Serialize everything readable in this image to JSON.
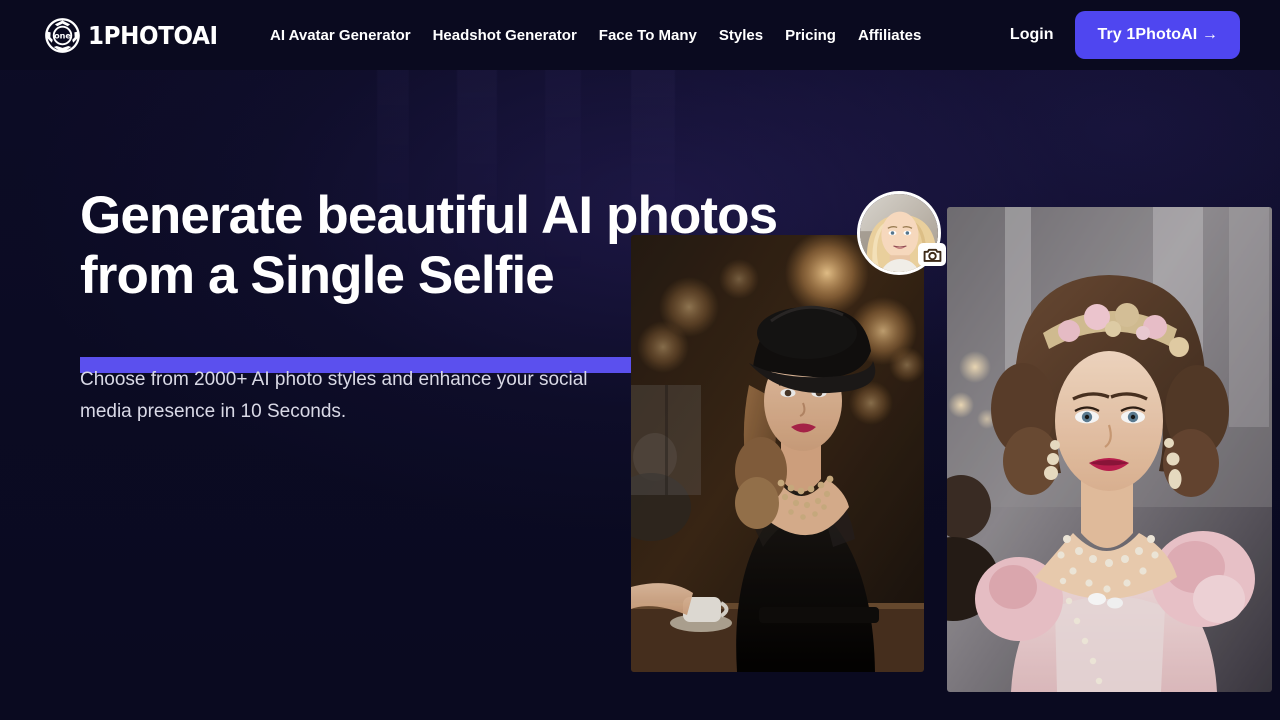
{
  "header": {
    "brand": {
      "name": "1PHOTOAI",
      "mark_label": "one",
      "icon": "aperture-icon"
    },
    "nav": [
      {
        "label": "AI Avatar Generator"
      },
      {
        "label": "Headshot Generator"
      },
      {
        "label": "Face To Many"
      },
      {
        "label": "Styles"
      },
      {
        "label": "Pricing"
      },
      {
        "label": "Affiliates"
      }
    ],
    "login_label": "Login",
    "cta_label": "Try 1PhotoAI →"
  },
  "hero": {
    "title_line_1": "Generate beautiful AI photos",
    "title_line_2": "from a Single Selfie",
    "subtitle": "Choose from 2000+ AI photo styles and enhance your social media presence in 10 Seconds.",
    "avatar_alt": "Blonde woman selfie avatar",
    "camera_icon": "camera-icon",
    "photos": [
      {
        "alt": "AI generated portrait of a woman in a black hat and black dress with a pearl necklace in a warmly lit cafe"
      },
      {
        "alt": "AI generated portrait of a woman in a pink gown with a floral tiara and layered pearl necklaces"
      }
    ]
  },
  "colors": {
    "background": "#0b0b24",
    "header_background": "#0a0a1f",
    "accent": "#4f46f0",
    "highlight_bar": "#5b50ee",
    "text_primary": "#ffffff",
    "text_secondary": "#d9d9e6"
  }
}
